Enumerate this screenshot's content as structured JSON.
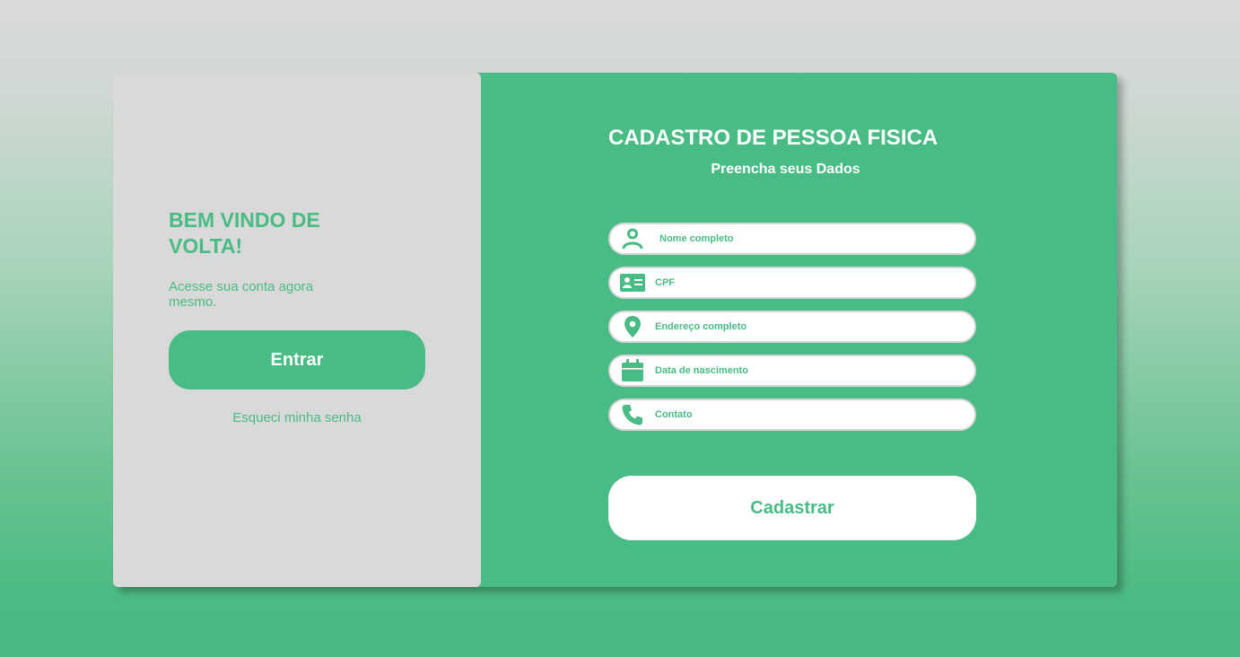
{
  "login": {
    "title": "BEM VINDO DE VOLTA!",
    "subtitle": "Acesse sua conta agora mesmo.",
    "button_label": "Entrar",
    "forgot_link": "Esqueci minha senha"
  },
  "register": {
    "title": "CADASTRO DE PESSOA FISICA",
    "subtitle": "Preencha seus Dados",
    "fields": [
      {
        "label": "Nome completo",
        "icon": "user-icon"
      },
      {
        "label": "CPF",
        "icon": "id-card-icon"
      },
      {
        "label": "Endereço completo",
        "icon": "location-pin-icon"
      },
      {
        "label": "Data de nascimento",
        "icon": "calendar-icon"
      },
      {
        "label": "Contato",
        "icon": "phone-icon"
      }
    ],
    "button_label": "Cadastrar"
  },
  "colors": {
    "accent": "#49bb84",
    "panel_gray": "#d9d9d9",
    "white": "#ffffff"
  }
}
